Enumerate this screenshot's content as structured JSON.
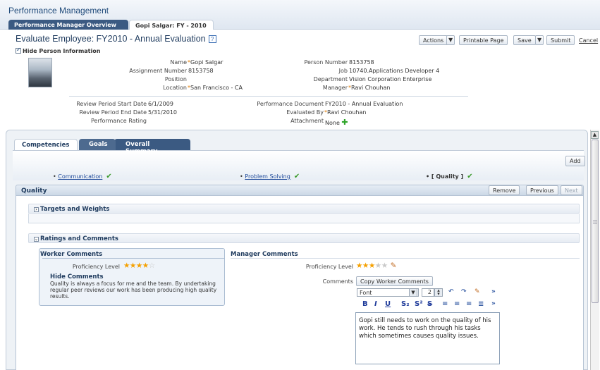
{
  "app": {
    "title": "Performance Management"
  },
  "tabs": [
    {
      "label": "Performance Manager Overview"
    },
    {
      "label": "Gopi Salgar: FY - 2010"
    }
  ],
  "header": {
    "title": "Evaluate Employee: FY2010 - Annual Evaluation",
    "help": "?",
    "hide_person_info": "Hide Person Information"
  },
  "toolbar": {
    "actions": "Actions",
    "printable_page": "Printable Page",
    "save": "Save",
    "submit": "Submit",
    "cancel": "Cancel"
  },
  "person": {
    "name_label": "Name",
    "name": "Gopi Salgar",
    "assignment_label": "Assignment Number",
    "assignment": "8153758",
    "position_label": "Position",
    "position": "",
    "location_label": "Location",
    "location": "San Francisco - CA",
    "person_number_label": "Person Number",
    "person_number": "8153758",
    "job_label": "Job",
    "job": "10740.Applications Developer 4",
    "department_label": "Department",
    "department": "Vision Corporation Enterprise",
    "manager_label": "Manager",
    "manager": "Ravi Chouhan"
  },
  "review": {
    "start_label": "Review Period Start Date",
    "start": "6/1/2009",
    "end_label": "Review Period End Date",
    "end": "5/31/2010",
    "rating_label": "Performance Rating",
    "rating": "",
    "doc_label": "Performance Document",
    "doc": "FY2010 - Annual Evaluation",
    "evaluated_label": "Evaluated By",
    "evaluated": "Ravi Chouhan",
    "attachment_label": "Attachment",
    "attachment": "None"
  },
  "subtabs": [
    {
      "label": "Competencies"
    },
    {
      "label": "Goals"
    },
    {
      "label": "Overall Summary"
    }
  ],
  "competencies": {
    "add": "Add",
    "items": [
      {
        "label": "Communication"
      },
      {
        "label": "Problem Solving"
      },
      {
        "label": "[ Quality ]"
      }
    ]
  },
  "quality": {
    "title": "Quality",
    "remove": "Remove",
    "previous": "Previous",
    "next": "Next",
    "targets_section": "Targets and Weights",
    "ratings_section": "Ratings and Comments"
  },
  "worker": {
    "header": "Worker Comments",
    "proficiency_label": "Proficiency Level",
    "proficiency": 4,
    "hide_comments": "Hide Comments",
    "comment": "Quality is always a focus for me and the team. By undertaking regular peer reviews our work has been producing high quality results."
  },
  "manager": {
    "header": "Manager Comments",
    "proficiency_label": "Proficiency Level",
    "proficiency": 3,
    "comments_label": "Comments",
    "copy_button": "Copy Worker Comments",
    "font_value": "Font",
    "size_value": "2",
    "comment": "Gopi still needs to work on the quality of his work. He tends to rush through his tasks which sometimes causes quality issues."
  },
  "colors": {
    "accent": "#3b5a82",
    "required": "#e07a00",
    "star": "#f5a000",
    "check": "#3a9a2a"
  }
}
